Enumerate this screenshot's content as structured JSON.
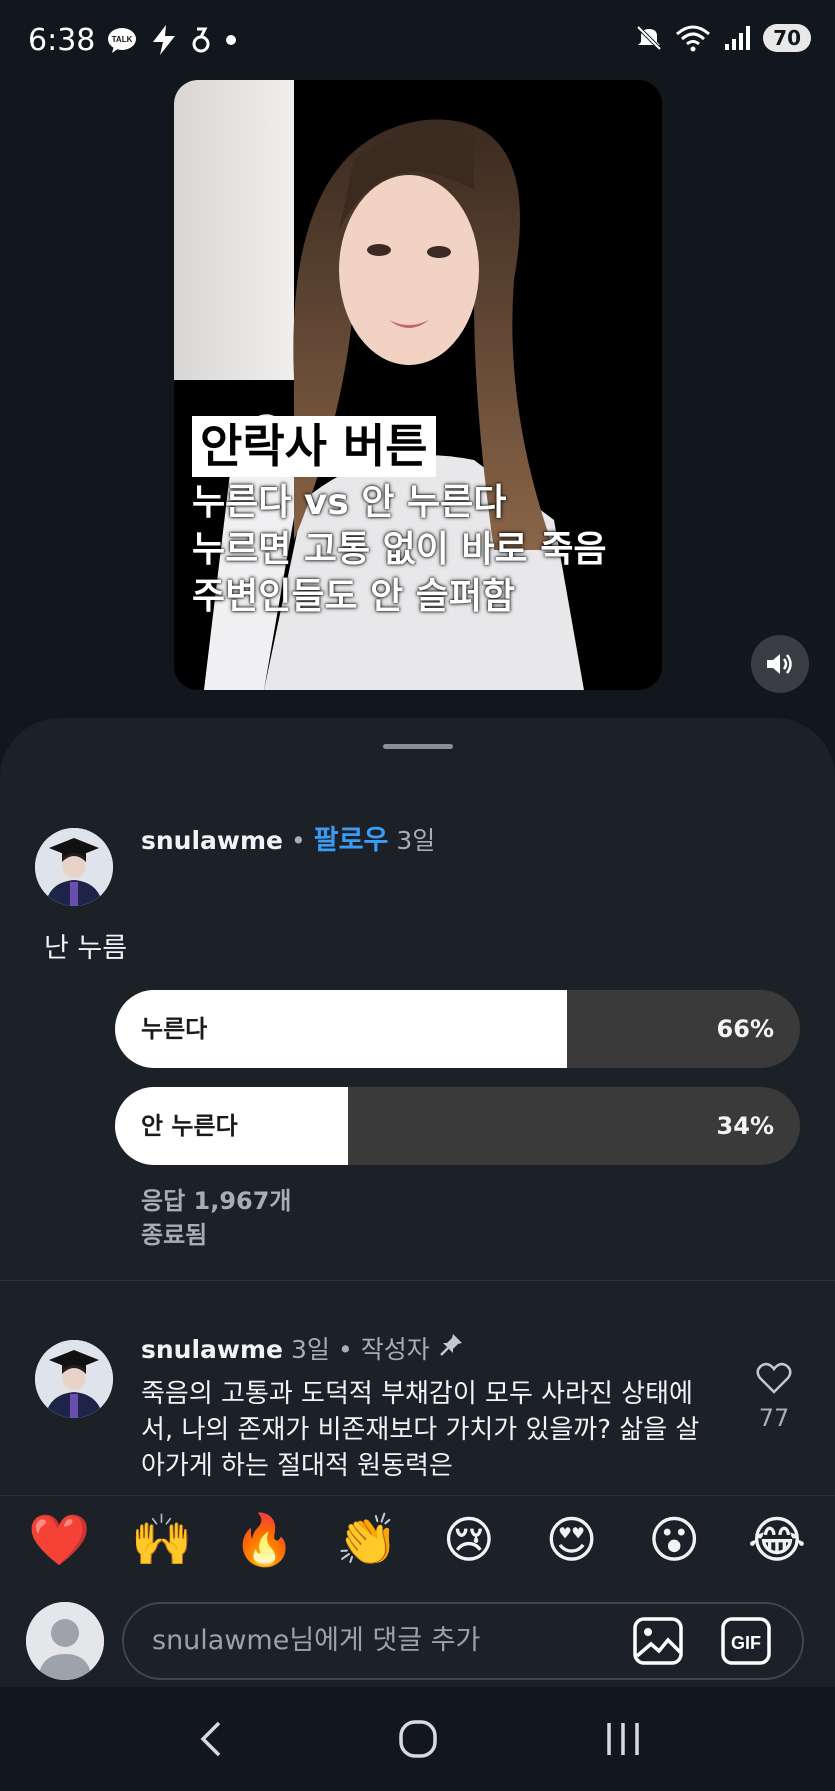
{
  "status_bar": {
    "time": "6:38",
    "talk_label": "TALK",
    "battery": "70",
    "icons": [
      "talk-icon",
      "bolt-icon",
      "app-icon",
      "dot-icon",
      "mute-icon",
      "wifi-icon",
      "signal-icon",
      "battery-icon"
    ]
  },
  "video": {
    "caption_title": "안락사 버튼",
    "caption_lines": [
      "누른다 vs 안 누른다",
      "누르면 고통 없이 바로 죽음",
      "주변인들도 안 슬퍼함"
    ]
  },
  "post": {
    "username": "snulawme",
    "separator": "•",
    "follow_label": "팔로우",
    "time": "3일",
    "text": "난 누름",
    "poll": {
      "options": [
        {
          "label": "누른다",
          "percent": "66%",
          "fraction": 0.66
        },
        {
          "label": "안 누른다",
          "percent": "34%",
          "fraction": 0.34
        }
      ],
      "responses": "응답 1,967개",
      "status": "종료됨"
    }
  },
  "comment": {
    "username": "snulawme",
    "time": "3일",
    "separator": "•",
    "author_label": "작성자",
    "text": "죽음의 고통과 도덕적 부채감이 모두 사라진 상태에서, 나의 존재가 비존재보다 가치가 있을까? 삶을 살아가게 하는 절대적 원동력은",
    "likes": "77"
  },
  "reactions": [
    "❤️",
    "🙌",
    "🔥",
    "👏",
    "😢",
    "😍",
    "😮",
    "😂"
  ],
  "composer": {
    "placeholder": "snulawme님에게 댓글 추가",
    "gif_label": "GIF"
  },
  "colors": {
    "background": "#12161d",
    "sheet": "#1c2027",
    "accent": "#3b9cf6",
    "poll_track": "#3a3a3b"
  }
}
